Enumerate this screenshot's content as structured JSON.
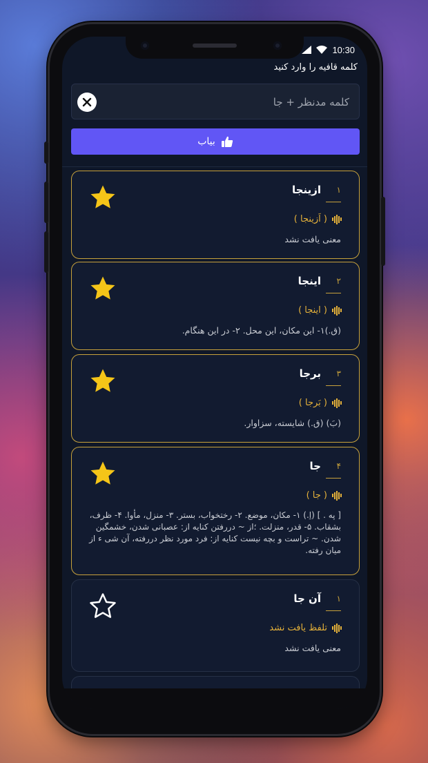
{
  "status": {
    "time": "10:30"
  },
  "prompt_label": "کلمه قافیه را وارد کنید",
  "search": {
    "placeholder": "کلمه مدنظر + جا",
    "value": ""
  },
  "find_button": {
    "label": "بیاب"
  },
  "results": [
    {
      "number": "۱",
      "word": "ازینجا",
      "pronunciation": "( اَزینجا )",
      "meaning": "معنی یافت نشد",
      "favorite": true
    },
    {
      "number": "۲",
      "word": "اینجا",
      "pronunciation": "( اینجا )",
      "meaning": "(ق.)۱- این مکان، این محل. ۲- در این هنگام.",
      "favorite": true
    },
    {
      "number": "۳",
      "word": "برجا",
      "pronunciation": "( بَرجا )",
      "meaning": "(بَ) (ق.) شایسته، سزاوار.",
      "favorite": true
    },
    {
      "number": "۴",
      "word": "جا",
      "pronunciation": "( جا )",
      "meaning": "[ په . ] (اِ.) ۱- مکان، موضع. ۲- رختخواب، بستر. ۳- منزل، مأوا. ۴- ظرف، بشقاب. ۵- قدر، منزلت. ؛از ~ دررفتن کنایه از: عصبانی شدن، خشمگین شدن. ~ تراست و بچه نیست کنایه از: فرد مورد نظر دررفته، آن شی ء از میان رفته.",
      "favorite": true
    },
    {
      "number": "۱",
      "word": "آن جا",
      "pronunciation": "تلفظ یافت نشد",
      "meaning": "معنی یافت نشد",
      "favorite": false
    }
  ],
  "colors": {
    "accent": "#6156f5",
    "gold": "#c8a23c",
    "star": "#f5c518",
    "background": "#0f1728"
  }
}
